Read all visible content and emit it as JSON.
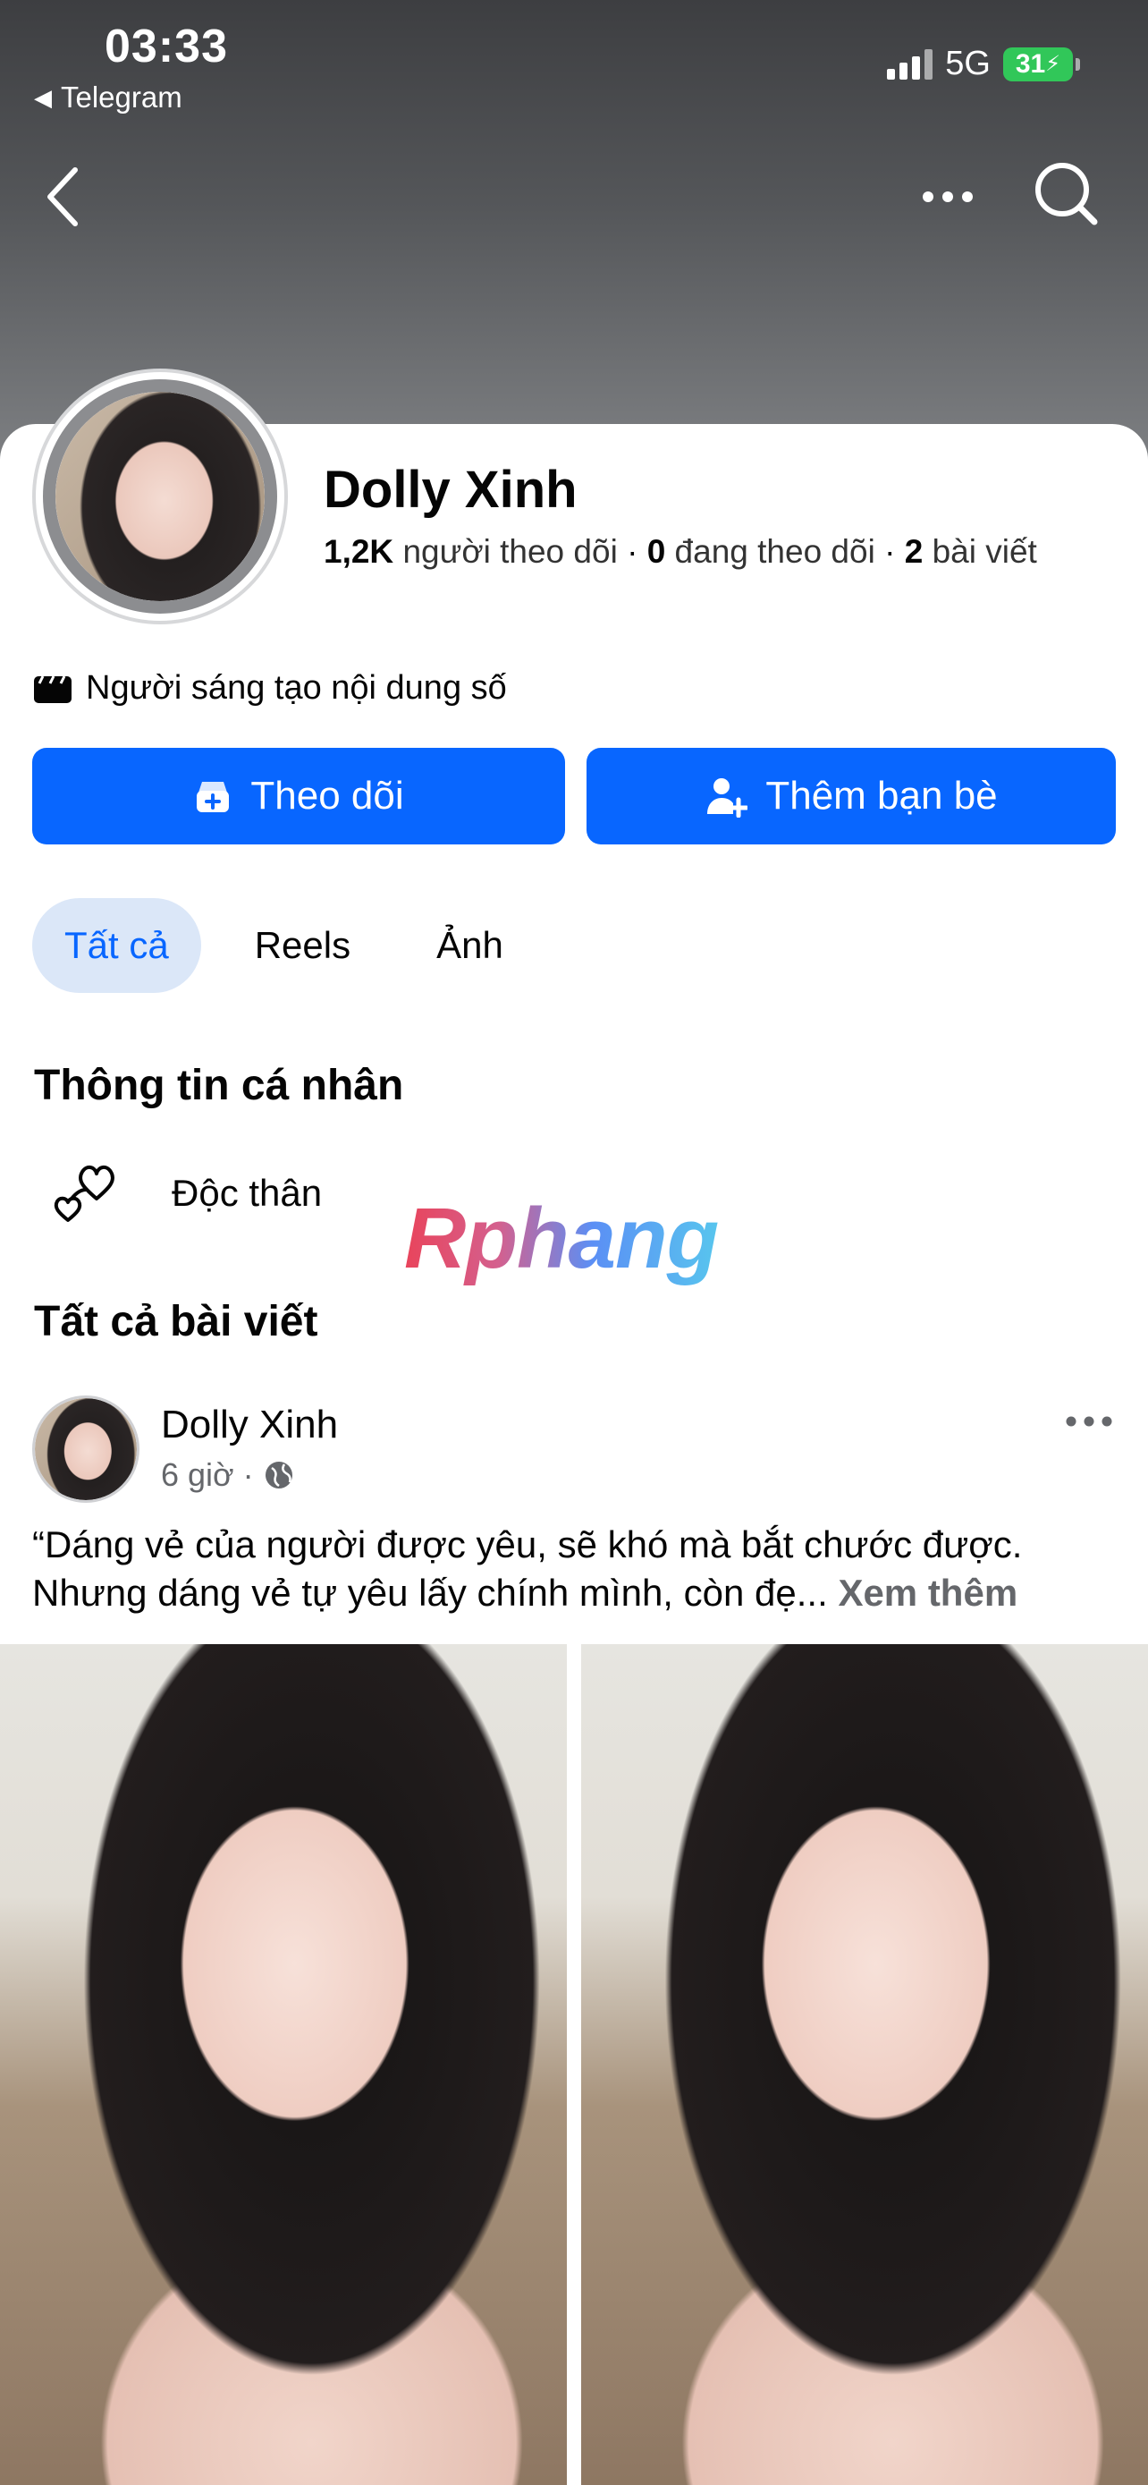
{
  "status_bar": {
    "time": "03:33",
    "back_app": "Telegram",
    "network": "5G",
    "battery": "31"
  },
  "profile": {
    "name": "Dolly Xinh",
    "followers_count": "1,2K",
    "followers_label": "người theo dõi",
    "following_count": "0",
    "following_label": "đang theo dõi",
    "posts_count": "2",
    "posts_label": "bài viết",
    "category": "Người sáng tạo nội dung số"
  },
  "actions": {
    "follow_label": "Theo dõi",
    "add_friend_label": "Thêm bạn bè"
  },
  "tabs": [
    {
      "label": "Tất cả",
      "active": true
    },
    {
      "label": "Reels",
      "active": false
    },
    {
      "label": "Ảnh",
      "active": false
    }
  ],
  "about": {
    "title": "Thông tin cá nhân",
    "relationship": "Độc thân"
  },
  "watermark": "Rphang",
  "posts_section": {
    "title": "Tất cả bài viết"
  },
  "post": {
    "author": "Dolly Xinh",
    "time": "6 giờ",
    "text_line1": "“Dáng vẻ của người được yêu, sẽ khó mà bắt chước được.",
    "text_line2": "Nhưng dáng vẻ tự yêu lấy chính mình, còn đẹ...",
    "see_more": "Xem thêm"
  },
  "colors": {
    "accent": "#0866ff",
    "tab_active_bg": "#dbe7f8",
    "muted_text": "#65676b"
  }
}
